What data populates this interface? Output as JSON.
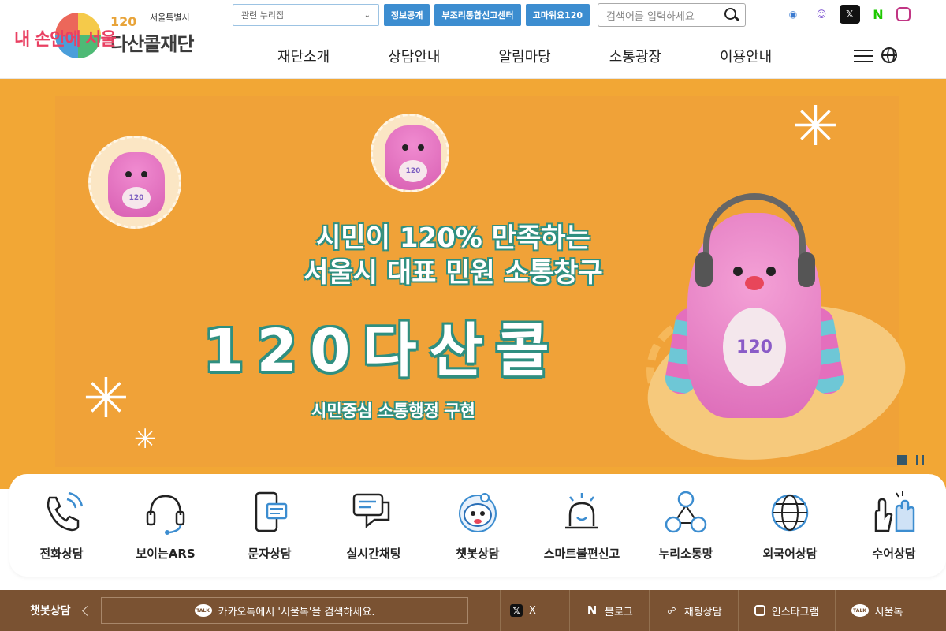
{
  "logo": {
    "badge": "내 손안에 서울",
    "city": "서울특별시",
    "number": "120",
    "name": "다산콜재단"
  },
  "topbar": {
    "related_select": "관련 누리집",
    "buttons": [
      "정보공개",
      "부조리통합신고센터",
      "고마워요120"
    ],
    "search_placeholder": "검색어를 입력하세요"
  },
  "sns_top": [
    "chatbot",
    "character",
    "X",
    "N",
    "instagram"
  ],
  "nav": {
    "items": [
      "재단소개",
      "상담안내",
      "알림마당",
      "소통광장",
      "이용안내"
    ]
  },
  "banner": {
    "line1": "시민이 120% 만족하는",
    "line2": "서울시 대표 민원 소통창구",
    "headline": "120다산콜",
    "subline": "시민중심 소통행정 구현",
    "monster_belly": "120",
    "colors": {
      "background": "#f2a735",
      "outline": "#2f8f80"
    }
  },
  "quick_menu": [
    {
      "label": "전화상담",
      "icon": "phone-icon"
    },
    {
      "label": "보이는ARS",
      "icon": "headset-icon"
    },
    {
      "label": "문자상담",
      "icon": "mobile-message-icon"
    },
    {
      "label": "실시간채팅",
      "icon": "chat-bubbles-icon"
    },
    {
      "label": "챗봇상담",
      "icon": "chatbot-icon"
    },
    {
      "label": "스마트불편신고",
      "icon": "alarm-bell-icon"
    },
    {
      "label": "누리소통망",
      "icon": "network-people-icon"
    },
    {
      "label": "외국어상담",
      "icon": "globe-icon"
    },
    {
      "label": "수어상담",
      "icon": "sign-hands-icon"
    }
  ],
  "bottom": {
    "label": "챗봇상담",
    "kakao_text": "카카오톡에서 '서울톡'을 검색하세요.",
    "links": [
      {
        "label": "X"
      },
      {
        "label": "블로그"
      },
      {
        "label": "채팅상담"
      },
      {
        "label": "인스타그램"
      },
      {
        "label": "서울톡"
      }
    ]
  }
}
